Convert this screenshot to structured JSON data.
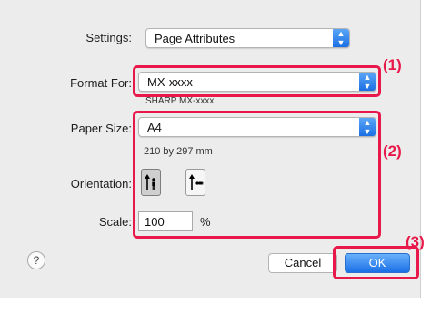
{
  "settings": {
    "label": "Settings:",
    "value": "Page Attributes"
  },
  "format": {
    "label": "Format For:",
    "value": "MX-xxxx",
    "subtitle": "SHARP MX-xxxx"
  },
  "paper": {
    "label": "Paper Size:",
    "value": "A4",
    "dimensions": "210 by 297 mm"
  },
  "orientation": {
    "label": "Orientation:",
    "selected": "portrait"
  },
  "scale": {
    "label": "Scale:",
    "value": "100",
    "unit": "%"
  },
  "buttons": {
    "help": "?",
    "cancel": "Cancel",
    "ok": "OK"
  },
  "markers": {
    "m1": "(1)",
    "m2": "(2)",
    "m3": "(3)"
  },
  "colors": {
    "highlight": "#e8194a",
    "accent": "#1b6fe4"
  },
  "icons": {
    "popup_arrow": "chevron-up-down-icon",
    "portrait": "portrait-orientation-icon",
    "landscape": "landscape-orientation-icon"
  }
}
